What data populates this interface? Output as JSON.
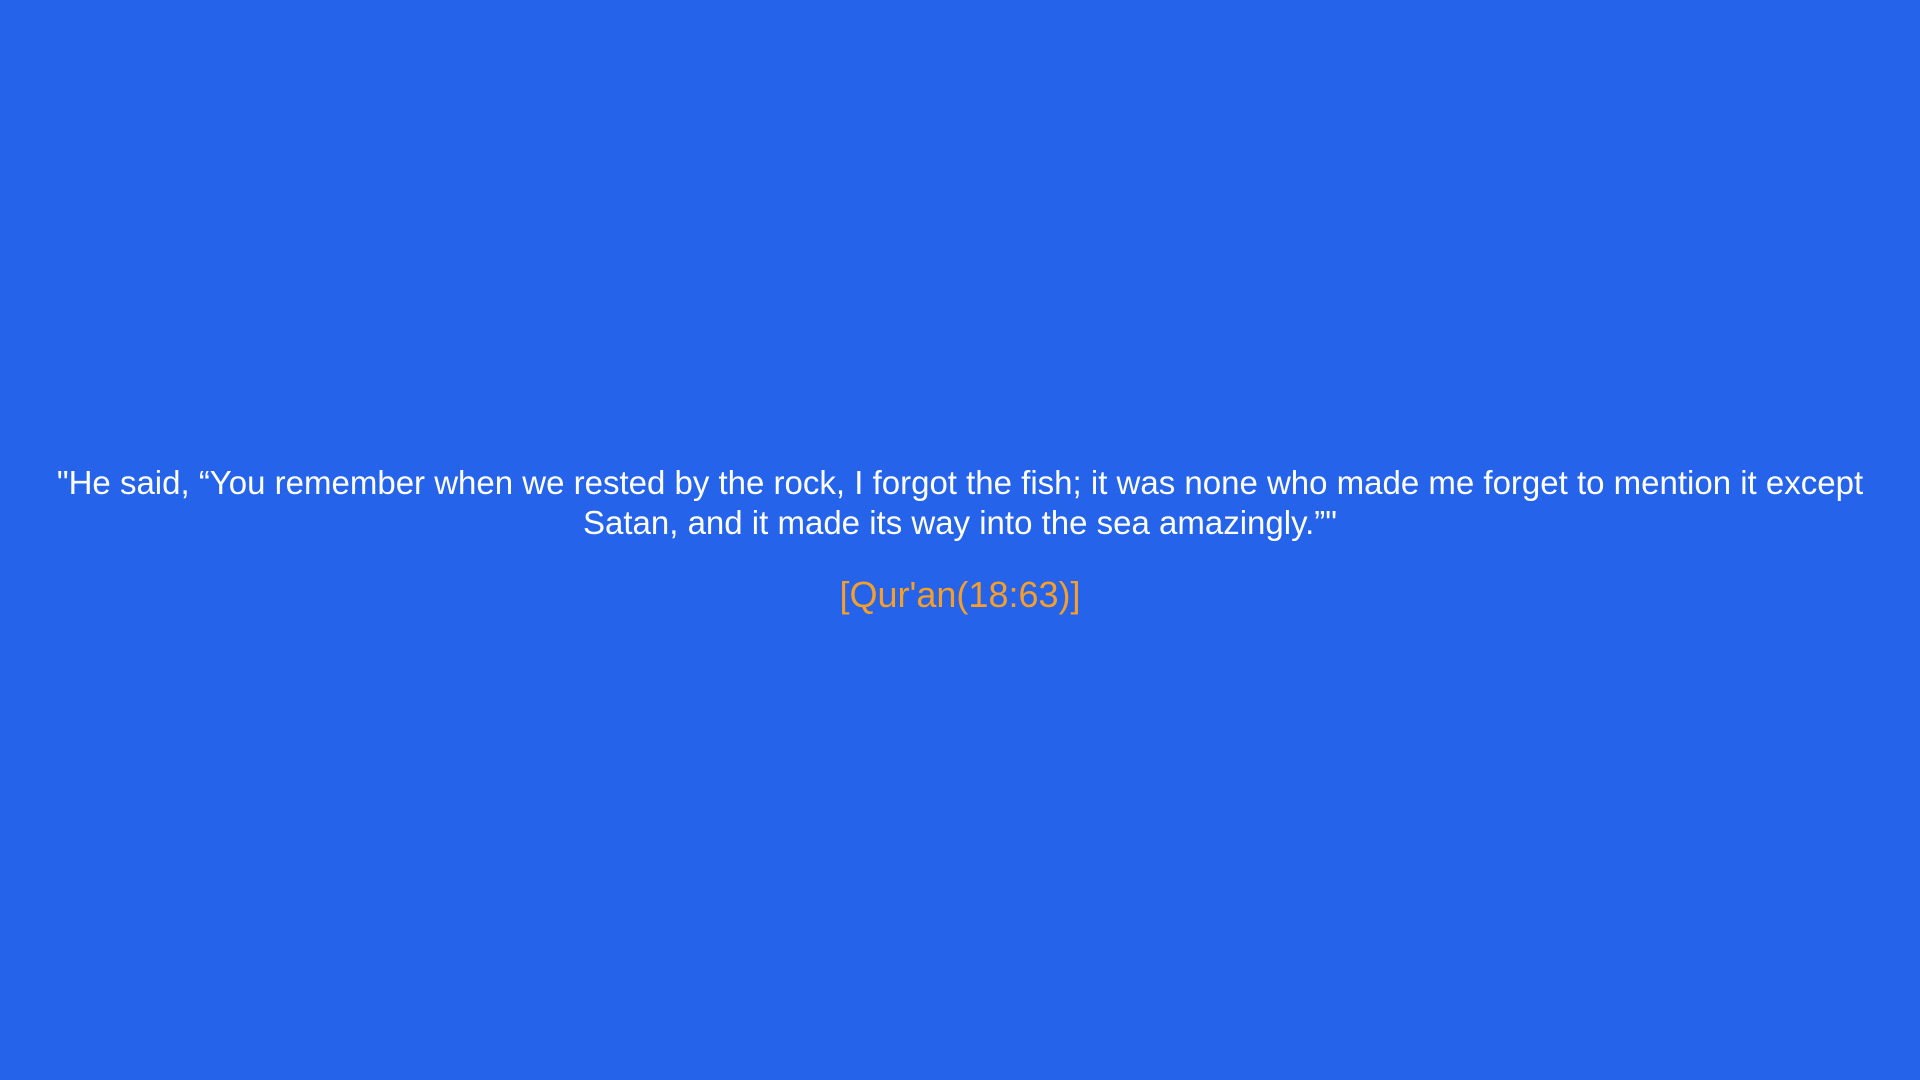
{
  "quote": {
    "text": "\"He said, “You remember when we rested by the rock, I forgot the fish; it was none who made me forget to mention it except Satan, and it made its way into the sea amazingly.”\"",
    "source": "[Qur'an(18:63)]"
  },
  "colors": {
    "background": "#2563eb",
    "text": "#ffffff",
    "source": "#f59e2b"
  }
}
